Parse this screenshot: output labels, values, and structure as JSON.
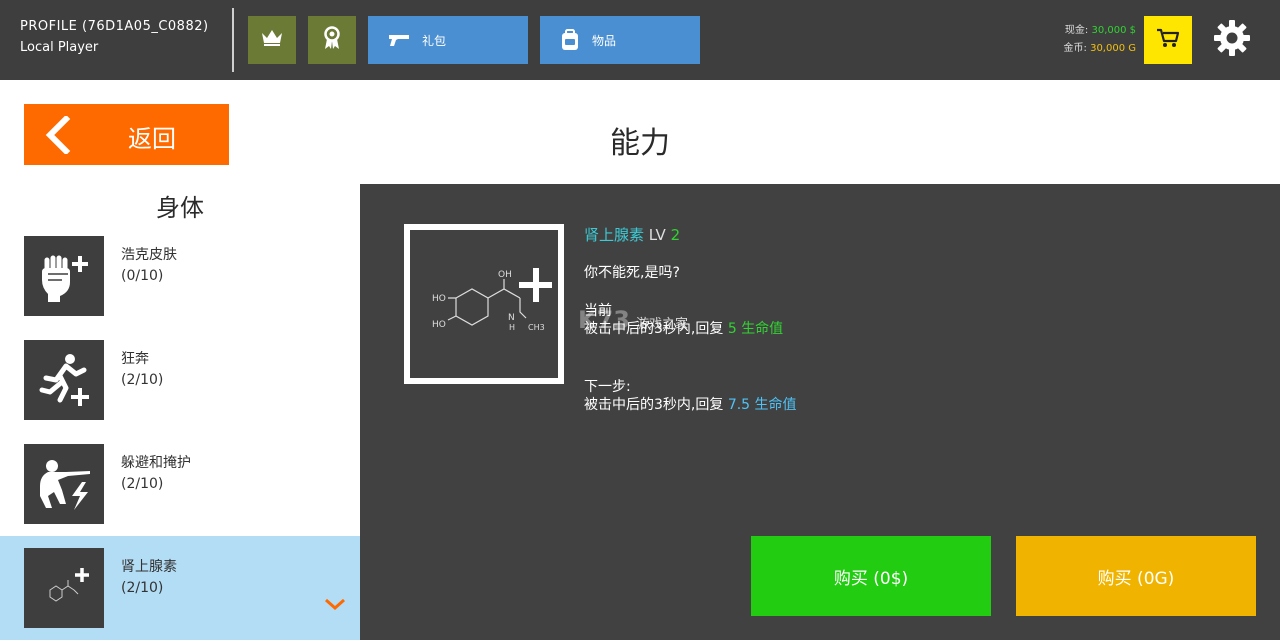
{
  "header": {
    "profile_id": "PROFILE (76D1A05_C0882)",
    "player_name": "Local Player",
    "gift_label": "礼包",
    "items_label": "物品",
    "cash_label": "现金:",
    "cash_value": "30,000 $",
    "gold_label": "金币:",
    "gold_value": "30,000 G",
    "icons": [
      "crown-icon",
      "ribbon-icon",
      "gun-icon",
      "backpack-icon",
      "cart-icon",
      "gear-icon"
    ]
  },
  "nav": {
    "back_label": "返回"
  },
  "page_title": "能力",
  "section_title": "身体",
  "skills": [
    {
      "name": "浩克皮肤",
      "progress": "(0/10)",
      "icon": "fist-plus-icon"
    },
    {
      "name": "狂奔",
      "progress": "(2/10)",
      "icon": "runner-plus-icon"
    },
    {
      "name": "躲避和掩护",
      "progress": "(2/10)",
      "icon": "soldier-bolt-icon"
    },
    {
      "name": "肾上腺素",
      "progress": "(2/10)",
      "icon": "molecule-plus-icon"
    }
  ],
  "detail": {
    "name": "肾上腺素",
    "lv_label": "LV",
    "level": "2",
    "description": "你不能死,是吗?",
    "current_label": "当前",
    "current_prefix": "被击中后的3秒内,回复",
    "current_value": "5",
    "unit": "生命值",
    "next_label": "下一步:",
    "next_prefix": "被击中后的3秒内,回复",
    "next_value": "7.5",
    "molecule_labels": {
      "oh": "OH",
      "ho1": "HO",
      "ho2": "HO",
      "nh": "N",
      "h": "H",
      "ch3": "CH3"
    }
  },
  "watermark": {
    "logo": "K73",
    "text": "游戏之家"
  },
  "buy": {
    "cash_label": "购买 (0$)",
    "gold_label": "购买 (0G)"
  },
  "colors": {
    "topbar": "#3e3e3e",
    "back": "#ff6a00",
    "selected": "#b3dcf5",
    "panel": "#414141",
    "buy_cash": "#22cc11",
    "buy_gold": "#f0b400",
    "cart": "#ffe600"
  }
}
